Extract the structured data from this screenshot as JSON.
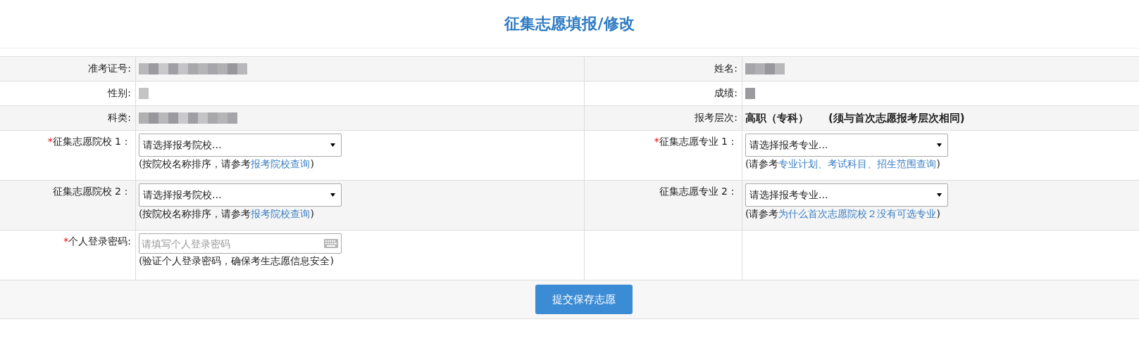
{
  "title": "征集志愿填报/修改",
  "rows": [
    {
      "cells": [
        {
          "kind": "info",
          "label": "准考证号:",
          "redacted": true
        },
        {
          "kind": "info",
          "label": "姓名:",
          "redacted": true
        }
      ]
    },
    {
      "cells": [
        {
          "kind": "info",
          "label": "性别:",
          "redacted": true
        },
        {
          "kind": "info",
          "label": "成绩:",
          "redacted": true
        }
      ]
    },
    {
      "cells": [
        {
          "kind": "info",
          "label": "科类:",
          "redacted": true
        },
        {
          "kind": "info",
          "label": "报考层次:",
          "value": "高职（专科）",
          "note": "(须与首次志愿报考层次相同)"
        }
      ]
    },
    {
      "cells": [
        {
          "kind": "select",
          "required_mark": "*",
          "label": "征集志愿院校 1：",
          "placeholder": "请选择报考院校...",
          "hint": "(按院校名称排序，请参考",
          "link": "报考院校查询",
          "hint_end": ")"
        },
        {
          "kind": "select",
          "required_mark": "*",
          "label": "征集志愿专业 1：",
          "placeholder": "请选择报考专业...",
          "hint": "(请参考",
          "link": "专业计划、考试科目、招生范围查询",
          "hint_end": ")"
        }
      ]
    },
    {
      "cells": [
        {
          "kind": "select",
          "label": "征集志愿院校 2：",
          "placeholder": "请选择报考院校...",
          "hint": "(按院校名称排序，请参考",
          "link": "报考院校查询",
          "hint_end": ")"
        },
        {
          "kind": "select",
          "label": "征集志愿专业 2：",
          "placeholder": "请选择报考专业...",
          "hint": "(请参考",
          "link": "为什么首次志愿院校２没有可选专业",
          "hint_end": ")"
        }
      ]
    },
    {
      "cells": [
        {
          "kind": "password",
          "required_mark": "*",
          "label": "个人登录密码:",
          "placeholder": "请填写个人登录密码",
          "hint": "(验证个人登录密码，确保考生志愿信息安全)"
        },
        {
          "kind": "empty"
        }
      ]
    }
  ],
  "submit_button": "提交保存志愿"
}
